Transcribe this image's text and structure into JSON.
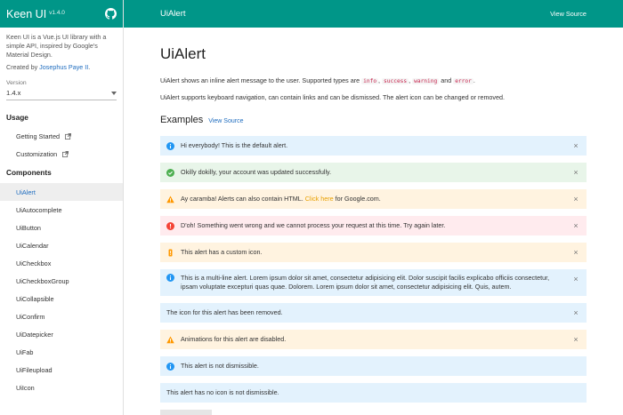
{
  "sidebar": {
    "brand": "Keen UI",
    "version_tag": "v1.4.0",
    "description": "Keen UI is a Vue.js UI library with a simple API, inspired by Google's Material Design.",
    "credit_prefix": "Created by ",
    "credit_author": "Josephus Paye II",
    "credit_suffix": ".",
    "version_label": "Version",
    "version_value": "1.4.x",
    "usage_heading": "Usage",
    "usage_items": [
      "Getting Started",
      "Customization"
    ],
    "components_heading": "Components",
    "components": [
      "UiAlert",
      "UiAutocomplete",
      "UiButton",
      "UiCalendar",
      "UiCheckbox",
      "UiCheckboxGroup",
      "UiCollapsible",
      "UiConfirm",
      "UiDatepicker",
      "UiFab",
      "UiFileupload",
      "UiIcon"
    ]
  },
  "topbar": {
    "title": "UiAlert",
    "view_source": "View Source"
  },
  "main": {
    "title": "UiAlert",
    "para1_prefix": "UiAlert shows an inline alert message to the user. Supported types are ",
    "types": [
      "info",
      "success",
      "warning",
      "error"
    ],
    "sep1": ", ",
    "sep2": ", ",
    "sep3": " and ",
    "para1_suffix": ".",
    "para2": "UiAlert supports keyboard navigation, can contain links and can be dismissed. The alert icon can be changed or removed.",
    "examples_title": "Examples",
    "examples_link": "View Source",
    "alerts": [
      {
        "type": "info",
        "icon": "info-icon",
        "text": "Hi everybody! This is the default alert."
      },
      {
        "type": "success",
        "icon": "check-circle-icon",
        "text": "Okilly dokilly, your account was updated successfully."
      },
      {
        "type": "warning",
        "icon": "warning-icon",
        "prefix": "Ay caramba! Alerts can also contain HTML. ",
        "link": "Click here",
        "suffix": " for Google.com."
      },
      {
        "type": "error",
        "icon": "error-icon",
        "text": "D'oh! Something went wrong and we cannot process your request at this time. Try again later."
      },
      {
        "type": "warning",
        "icon": "custom-icon",
        "text": "This alert has a custom icon."
      },
      {
        "type": "info",
        "icon": "info-icon",
        "text": "This is a multi-line alert. Lorem ipsum dolor sit amet, consectetur adipisicing elit. Dolor suscipit facilis explicabo officiis consectetur, ipsam voluptate excepturi quas quae. Dolorem. Lorem ipsum dolor sit amet, consectetur adipisicing elit. Quis, autem."
      },
      {
        "type": "info",
        "icon": "",
        "text": "The icon for this alert has been removed."
      },
      {
        "type": "warning",
        "icon": "warning-icon",
        "text": "Animations for this alert are disabled."
      },
      {
        "type": "info",
        "icon": "info-icon",
        "text": "This alert is not dismissible."
      },
      {
        "type": "info",
        "icon": "",
        "text": "This alert has no icon is not dismissible."
      }
    ],
    "close_glyph": "×"
  },
  "colors": {
    "primary": "#009688",
    "link": "#1e6cbf",
    "info_icon": "#2196f3",
    "success_icon": "#4caf50",
    "warning_icon": "#ff9800",
    "error_icon": "#f44336"
  }
}
